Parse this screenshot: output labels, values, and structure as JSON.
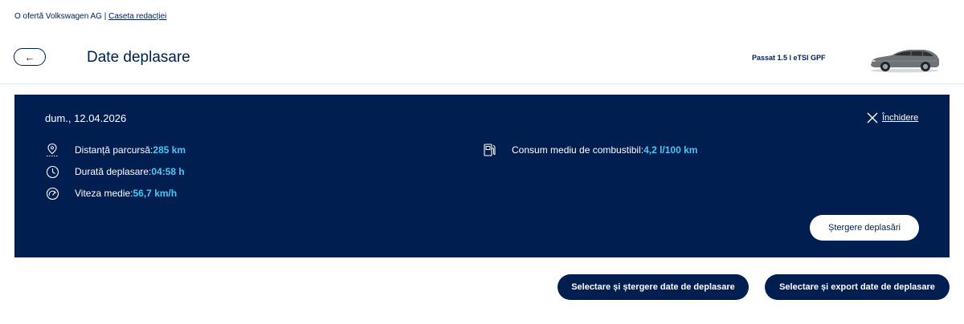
{
  "header": {
    "offer_text": "O ofertă Volkswagen AG | ",
    "newsroom_link": "Caseta redacției",
    "back_arrow": "←",
    "title": "Date deplasare",
    "car_name": "Passat 1.5 l eTSI GPF"
  },
  "trip": {
    "date": "dum., 12.04.2026",
    "close_label": "Închidere",
    "stats": {
      "distance": {
        "label": "Distanță parcursă:",
        "value": "285 km",
        "icon": "location-pin-icon"
      },
      "duration": {
        "label": "Durată deplasare:",
        "value": "04:58 h",
        "icon": "clock-icon"
      },
      "speed": {
        "label": "Viteza medie:",
        "value": "56,7 km/h",
        "icon": "speedometer-icon"
      },
      "consumption": {
        "label": "Consum mediu de combustibil:",
        "value": "4,2 l/100 km",
        "icon": "fuel-pump-icon"
      }
    },
    "delete_button": "Ștergere deplasări"
  },
  "actions": {
    "select_delete": "Selectare și ștergere date de deplasare",
    "select_export": "Selectare și export date de deplasare"
  },
  "colors": {
    "brand_navy": "#001e50",
    "accent_blue": "#4cc7f4",
    "white": "#ffffff"
  }
}
